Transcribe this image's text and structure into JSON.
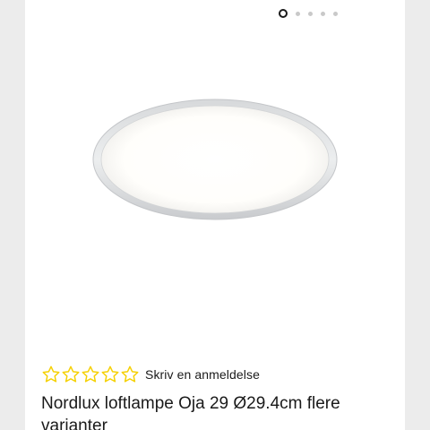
{
  "gallery": {
    "image_count": 5,
    "active_index": 0,
    "image_alt": "Rund hvid LED loftlampe"
  },
  "rating": {
    "stars_total": 5,
    "stars_filled": 0,
    "star_color": "#f5d000",
    "review_link": "Skriv en anmeldelse"
  },
  "product": {
    "title": "Nordlux loftlampe Oja 29 Ø29.4cm flere varianter"
  }
}
